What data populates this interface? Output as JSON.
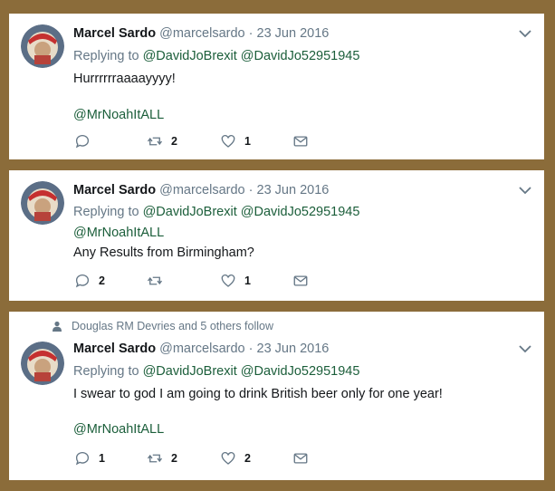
{
  "tweets": [
    {
      "name": "Marcel Sardo",
      "handle": "@marcelsardo",
      "separator": "·",
      "date": "23 Jun 2016",
      "replying_prefix": "Replying to",
      "replying_to": [
        "@DavidJoBrexit",
        "@DavidJo52951945"
      ],
      "lines": [
        {
          "text": "Hurrrrrraaaayyyy!",
          "kind": "text"
        },
        {
          "text": "@MrNoahItALL",
          "kind": "mention"
        }
      ],
      "actions": {
        "reply_count": "",
        "retweet_count": "2",
        "like_count": "1"
      }
    },
    {
      "name": "Marcel Sardo",
      "handle": "@marcelsardo",
      "separator": "·",
      "date": "23 Jun 2016",
      "replying_prefix": "Replying to",
      "replying_to": [
        "@DavidJoBrexit",
        "@DavidJo52951945"
      ],
      "lines": [
        {
          "text": "@MrNoahItALL",
          "kind": "mention"
        },
        {
          "text": "Any Results from Birmingham?",
          "kind": "text"
        }
      ],
      "actions": {
        "reply_count": "2",
        "retweet_count": "",
        "like_count": "1"
      }
    },
    {
      "social_context": "Douglas RM Devries and 5 others follow",
      "name": "Marcel Sardo",
      "handle": "@marcelsardo",
      "separator": "·",
      "date": "23 Jun 2016",
      "replying_prefix": "Replying to",
      "replying_to": [
        "@DavidJoBrexit",
        "@DavidJo52951945"
      ],
      "lines": [
        {
          "text": "I swear to god I am going to drink British beer only for one year!",
          "kind": "text"
        },
        {
          "text": "@MrNoahItALL",
          "kind": "mention"
        }
      ],
      "actions": {
        "reply_count": "1",
        "retweet_count": "2",
        "like_count": "2"
      }
    }
  ],
  "colors": {
    "frame": "#8b6c3a",
    "mention": "#1b5e3a",
    "muted": "#657786"
  },
  "icons": [
    "person-icon",
    "reply-icon",
    "retweet-icon",
    "like-icon",
    "message-icon",
    "chevron-down-icon"
  ]
}
